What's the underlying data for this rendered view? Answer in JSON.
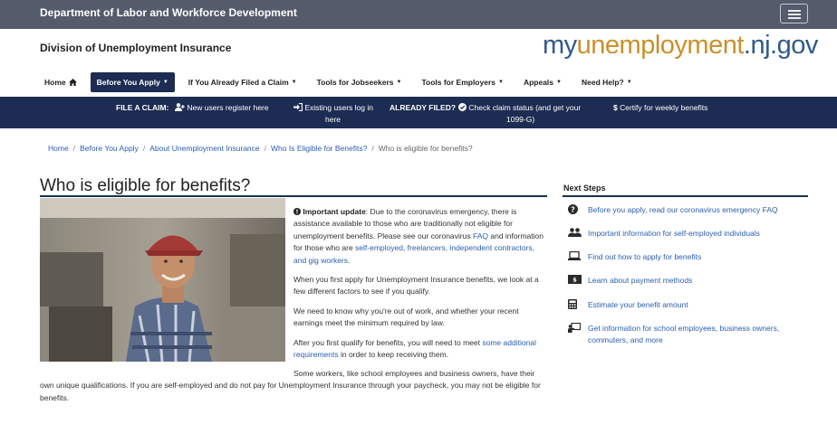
{
  "topbar": {
    "department": "Department of Labor and Workforce Development"
  },
  "header": {
    "division": "Division of Unemployment Insurance",
    "logo": {
      "part1": "my",
      "part2": "unemployment",
      "part3": ".nj.gov"
    }
  },
  "nav": {
    "items": [
      {
        "label": "Home",
        "icon": "home-icon"
      },
      {
        "label": "Before You Apply",
        "caret": "▼"
      },
      {
        "label": "If You Already Filed a Claim",
        "caret": "▼"
      },
      {
        "label": "Tools for Jobseekers",
        "caret": "▼"
      },
      {
        "label": "Tools for Employers",
        "caret": "▼"
      },
      {
        "label": "Appeals",
        "caret": "▼"
      },
      {
        "label": "Need Help?",
        "caret": "▼"
      }
    ]
  },
  "claimbar": {
    "file_label": "FILE A CLAIM:",
    "new_users": "New users register here",
    "existing_users_1": "Existing users log in",
    "existing_users_2": "here",
    "already_label": "ALREADY FILED?",
    "check_status_1": "Check claim status (and get your",
    "check_status_2": "1099-G)",
    "certify": "Certify for weekly benefits"
  },
  "breadcrumb": {
    "items": [
      "Home",
      "Before You Apply",
      "About Unemployment Insurance",
      "Who Is Eligible for Benefits?"
    ],
    "current": "Who is eligible for benefits?"
  },
  "main": {
    "title": "Who is eligible for benefits?",
    "important_label": "Important update",
    "p1_a": ": Due to the coronavirus emergency, there is assistance available to those who are traditionally not eligible for unemployment benefits. Please see our coronavirus ",
    "p1_link1": "FAQ",
    "p1_b": " and information for those who are ",
    "p1_link2": "self-employed, freelancers, independent contractors, and gig workers",
    "p1_c": ".",
    "p2": "When you first apply for Unemployment Insurance benefits, we look at a few different factors to see if you qualify.",
    "p3": "We need to know why you're out of work, and whether your recent earnings meet the minimum required by law.",
    "p4_a": "After you first qualify for benefits, you will need to meet ",
    "p4_link": "some additional requirements",
    "p4_b": " in order to keep receiving them.",
    "p5_a": "Some workers, like school employees and business owners, have their",
    "p5_b": "own unique qualifications. If you are self-employed and do not pay for Unemployment Insurance through your paycheck, you may not be eligible for benefits."
  },
  "next_steps": {
    "title": "Next Steps",
    "items": [
      {
        "icon": "question-circle-icon",
        "label": "Before you apply, read our coronavirus emergency FAQ"
      },
      {
        "icon": "users-icon",
        "label": "Important information for self-employed individuals"
      },
      {
        "icon": "laptop-icon",
        "label": "Find out how to apply for benefits"
      },
      {
        "icon": "money-icon",
        "label": "Learn about payment methods"
      },
      {
        "icon": "calculator-icon",
        "label": "Estimate your benefit amount"
      },
      {
        "icon": "presentation-icon",
        "label": "Get information for school employees, business owners, commuters, and more"
      }
    ]
  },
  "colors": {
    "topbar": "#545b6b",
    "navy": "#1c2c52",
    "link": "#2a5eb0",
    "logo_gold": "#c9912a",
    "logo_blue": "#2f5a8c"
  }
}
